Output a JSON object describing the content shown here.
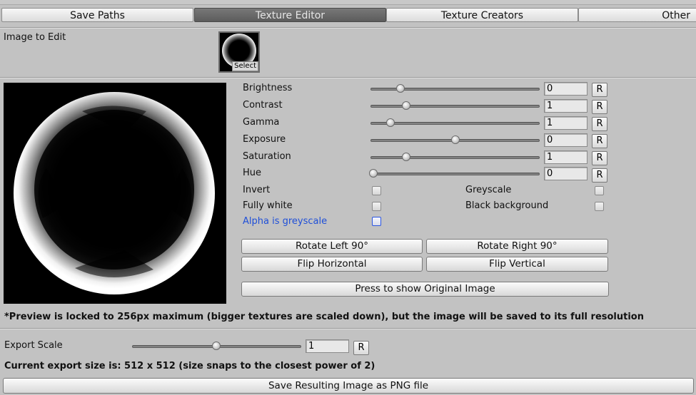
{
  "tabs": [
    {
      "label": "Save Paths",
      "active": false
    },
    {
      "label": "Texture Editor",
      "active": true
    },
    {
      "label": "Texture Creators",
      "active": false
    },
    {
      "label": "Other",
      "active": false
    }
  ],
  "image_section": {
    "label": "Image to Edit",
    "select_label": "Select"
  },
  "adjustments": [
    {
      "label": "Brightness",
      "value": "0",
      "fraction": 0.17,
      "reset": "R"
    },
    {
      "label": "Contrast",
      "value": "1",
      "fraction": 0.21,
      "reset": "R"
    },
    {
      "label": "Gamma",
      "value": "1",
      "fraction": 0.11,
      "reset": "R"
    },
    {
      "label": "Exposure",
      "value": "0",
      "fraction": 0.5,
      "reset": "R"
    },
    {
      "label": "Saturation",
      "value": "1",
      "fraction": 0.21,
      "reset": "R"
    },
    {
      "label": "Hue",
      "value": "0",
      "fraction": 0.0,
      "reset": "R"
    }
  ],
  "toggles": {
    "invert": "Invert",
    "fully_white": "Fully white",
    "alpha_is_greyscale": "Alpha is greyscale",
    "greyscale": "Greyscale",
    "black_background": "Black background"
  },
  "buttons": {
    "rotate_left": "Rotate Left 90°",
    "rotate_right": "Rotate Right 90°",
    "flip_horizontal": "Flip Horizontal",
    "flip_vertical": "Flip Vertical",
    "show_original": "Press to show Original Image"
  },
  "preview_note": "*Preview is locked to 256px maximum (bigger textures are scaled down), but the image will be saved to its full resolution",
  "export": {
    "label": "Export Scale",
    "value": "1",
    "fraction": 0.5,
    "reset": "R",
    "size_text": "Current export size is: 512 x 512 (size snaps to the closest power of 2)",
    "save_button": "Save Resulting Image as PNG file"
  },
  "colors": {
    "background": "#c2c2c2",
    "active_tab": "#6a6a6a",
    "highlight_label": "#1f4fd8"
  }
}
